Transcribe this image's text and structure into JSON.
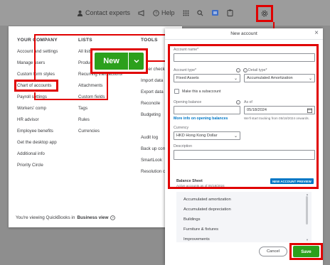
{
  "topbar": {
    "contact_experts": "Contact experts",
    "help": "Help"
  },
  "menu": {
    "your_company": {
      "heading": "YOUR COMPANY",
      "items": [
        "Account and settings",
        "Manage users",
        "Custom form styles",
        "Chart of accounts",
        "Payroll settings",
        "Workers' comp",
        "HR advisor",
        "Employee benefits",
        "Get the desktop app",
        "Additional info",
        "Priority Circle"
      ]
    },
    "lists": {
      "heading": "LISTS",
      "items": [
        "All lists",
        "Products and services",
        "Recurring transactions",
        "Attachments",
        "Custom fields",
        "Tags",
        "Rules",
        "Currencies"
      ]
    },
    "tools": {
      "heading": "TOOLS",
      "items": [
        "Order checks",
        "Import data",
        "Export data",
        "Reconcile",
        "Budgeting",
        "Audit log",
        "Back up company",
        "SmartLook",
        "Resolution center"
      ]
    },
    "footer_prefix": "You're viewing QuickBooks in",
    "footer_view": "Business view",
    "new_button": "New"
  },
  "modal": {
    "title": "New account",
    "account_name_label": "Account name*",
    "account_name_value": "",
    "account_type_label": "Account type*",
    "account_type_value": "Fixed Assets",
    "detail_type_label": "Detail type*",
    "detail_type_value": "Accumulated Amortization",
    "subaccount_label": "Make this a subaccount",
    "opening_balance_label": "Opening balance",
    "opening_balance_value": "",
    "as_of_label": "As of",
    "as_of_value": "05/18/2024",
    "opening_balance_link": "More info on opening balances",
    "tracking_note": "We'll start tracking from 05/18/2024 onwards.",
    "currency_label": "Currency",
    "currency_value": "HKD Hong Kong Dollar",
    "description_label": "Description",
    "description_value": "",
    "balance_sheet_heading": "Balance Sheet",
    "balance_sheet_sub": "Active accounts as of 05/18/2024",
    "preview_badge": "NEW ACCOUNT PREVIEW",
    "preview_items": [
      "Accumulated amortization",
      "Accumulated depreciation",
      "Buildings",
      "Furniture & fixtures",
      "Improvements"
    ],
    "cancel": "Cancel",
    "save": "Save"
  },
  "colors": {
    "highlight": "#e00000",
    "qb_green": "#2ca01c",
    "link_blue": "#0077c5"
  }
}
